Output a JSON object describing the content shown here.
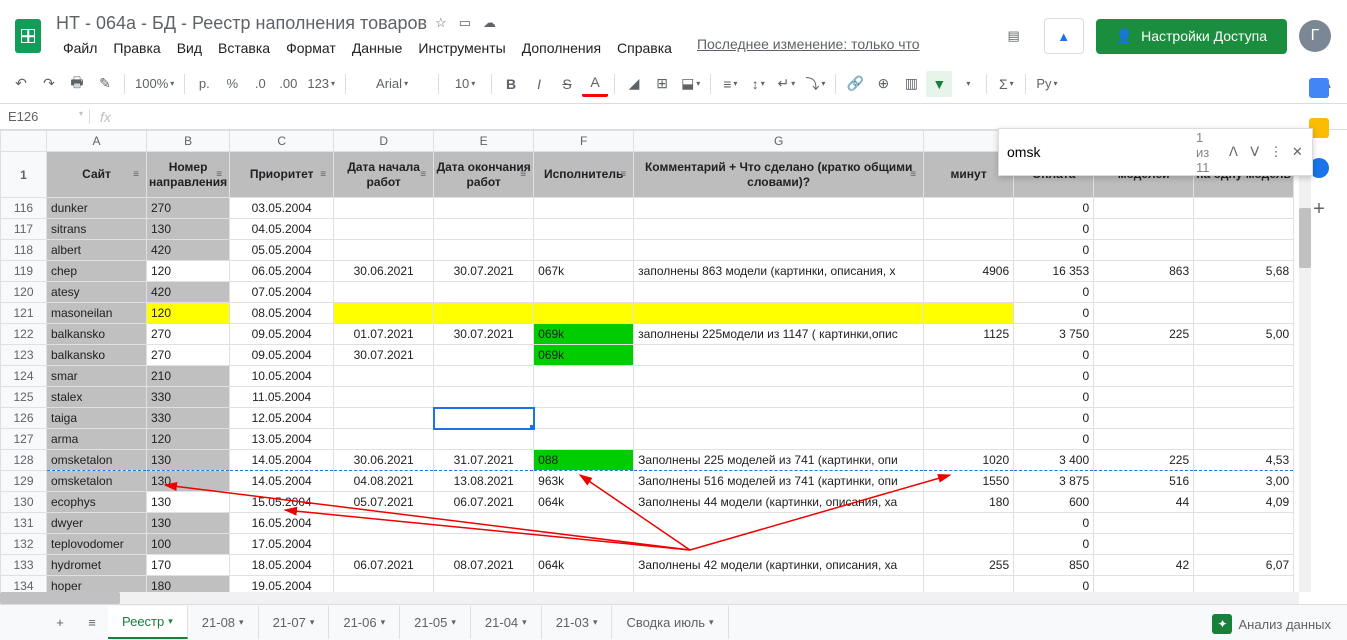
{
  "doc": {
    "title": "НТ - 064а - БД - Реестр наполнения товаров"
  },
  "menu": [
    "Файл",
    "Правка",
    "Вид",
    "Вставка",
    "Формат",
    "Данные",
    "Инструменты",
    "Дополнения",
    "Справка"
  ],
  "last_edit": "Последнее изменение: только что",
  "share": "Настройки Доступа",
  "avatar": "Г",
  "toolbar": {
    "zoom": "100%",
    "currency": "р.",
    "pct": "%",
    "dec_less": ".0",
    "dec_more": ".00",
    "fmt": "123",
    "font": "Arial",
    "size": "10",
    "script": "Ру"
  },
  "name_box": "E126",
  "fx": "fx",
  "find": {
    "query": "omsk",
    "count": "1 из 11"
  },
  "cols": {
    "A": "A",
    "B": "B",
    "C": "C",
    "D": "D",
    "E": "E",
    "F": "F",
    "G": "G",
    "I": "",
    "J": "",
    "K": "",
    "L": ""
  },
  "headers": {
    "A": "Сайт",
    "B": "Номер направления",
    "C": "Приоритет",
    "D": "Дата начала работ",
    "E": "Дата окончания работ",
    "F": "Исполнитель",
    "G": "Комментарий + Что сделано (кратко общими словами)?",
    "I": "минут",
    "J": "Оплата",
    "K": "моделей",
    "L": "на одну модель"
  },
  "rows": [
    {
      "n": "116",
      "site": "dunker",
      "num": "270",
      "prio": "03.05.2004",
      "d1": "",
      "d2": "",
      "exe": "",
      "com": "",
      "min": "",
      "pay": "0",
      "mod": "",
      "per": "",
      "gray": true
    },
    {
      "n": "117",
      "site": "sitrans",
      "num": "130",
      "prio": "04.05.2004",
      "d1": "",
      "d2": "",
      "exe": "",
      "com": "",
      "min": "",
      "pay": "0",
      "mod": "",
      "per": "",
      "gray": true
    },
    {
      "n": "118",
      "site": "albert",
      "num": "420",
      "prio": "05.05.2004",
      "d1": "",
      "d2": "",
      "exe": "",
      "com": "",
      "min": "",
      "pay": "0",
      "mod": "",
      "per": "",
      "gray": true
    },
    {
      "n": "119",
      "site": "chep",
      "num": "120",
      "prio": "06.05.2004",
      "d1": "30.06.2021",
      "d2": "30.07.2021",
      "exe": "067k",
      "com": "заполнены 863 модели (картинки, описания, х",
      "min": "4906",
      "pay": "16 353",
      "mod": "863",
      "per": "5,68"
    },
    {
      "n": "120",
      "site": "atesy",
      "num": "420",
      "prio": "07.05.2004",
      "d1": "",
      "d2": "",
      "exe": "",
      "com": "",
      "min": "",
      "pay": "0",
      "mod": "",
      "per": "",
      "gray": true
    },
    {
      "n": "121",
      "site": "masoneilan",
      "num": "120",
      "prio": "08.05.2004",
      "d1": "",
      "d2": "",
      "exe": "",
      "com": "",
      "min": "",
      "pay": "0",
      "mod": "",
      "per": "",
      "gray": true,
      "yellow": true
    },
    {
      "n": "122",
      "site": "balkansko",
      "num": "270",
      "prio": "09.05.2004",
      "d1": "01.07.2021",
      "d2": "30.07.2021",
      "exe": "069k",
      "com": "заполнены 225модели из 1147 ( картинки,опис",
      "min": "1125",
      "pay": "3 750",
      "mod": "225",
      "per": "5,00",
      "green_exe": true
    },
    {
      "n": "123",
      "site": "balkansko",
      "num": "270",
      "prio": "09.05.2004",
      "d1": "30.07.2021",
      "d2": "",
      "exe": "069k",
      "com": "",
      "min": "",
      "pay": "0",
      "mod": "",
      "per": "",
      "green_exe": true
    },
    {
      "n": "124",
      "site": "smar",
      "num": "210",
      "prio": "10.05.2004",
      "d1": "",
      "d2": "",
      "exe": "",
      "com": "",
      "min": "",
      "pay": "0",
      "mod": "",
      "per": "",
      "gray": true
    },
    {
      "n": "125",
      "site": "stalex",
      "num": "330",
      "prio": "11.05.2004",
      "d1": "",
      "d2": "",
      "exe": "",
      "com": "",
      "min": "",
      "pay": "0",
      "mod": "",
      "per": "",
      "gray": true
    },
    {
      "n": "126",
      "site": "taiga",
      "num": "330",
      "prio": "12.05.2004",
      "d1": "",
      "d2": "",
      "exe": "",
      "com": "",
      "min": "",
      "pay": "0",
      "mod": "",
      "per": "",
      "gray": true,
      "sel": true
    },
    {
      "n": "127",
      "site": "arma",
      "num": "120",
      "prio": "13.05.2004",
      "d1": "",
      "d2": "",
      "exe": "",
      "com": "",
      "min": "",
      "pay": "0",
      "mod": "",
      "per": "",
      "gray": true
    },
    {
      "n": "128",
      "site": "omsketalon",
      "num": "130",
      "prio": "14.05.2004",
      "d1": "30.06.2021",
      "d2": "31.07.2021",
      "exe": "088",
      "com": "Заполнены 225 моделей из 741 (картинки, опи",
      "min": "1020",
      "pay": "3 400",
      "mod": "225",
      "per": "4,53",
      "gray": true,
      "green_exe": true,
      "dash": true
    },
    {
      "n": "129",
      "site": "omsketalon",
      "num": "130",
      "prio": "14.05.2004",
      "d1": "04.08.2021",
      "d2": "13.08.2021",
      "exe": "963k",
      "com": "Заполнены 516 моделей из 741 (картинки, опи",
      "min": "1550",
      "pay": "3 875",
      "mod": "516",
      "per": "3,00",
      "gray": true,
      "dash": true
    },
    {
      "n": "130",
      "site": "ecophys",
      "num": "130",
      "prio": "15.05.2004",
      "d1": "05.07.2021",
      "d2": "06.07.2021",
      "exe": "064k",
      "com": "Заполнены 44 модели (картинки, описания, ха",
      "min": "180",
      "pay": "600",
      "mod": "44",
      "per": "4,09"
    },
    {
      "n": "131",
      "site": "dwyer",
      "num": "130",
      "prio": "16.05.2004",
      "d1": "",
      "d2": "",
      "exe": "",
      "com": "",
      "min": "",
      "pay": "0",
      "mod": "",
      "per": "",
      "gray": true
    },
    {
      "n": "132",
      "site": "teplovodomer",
      "num": "100",
      "prio": "17.05.2004",
      "d1": "",
      "d2": "",
      "exe": "",
      "com": "",
      "min": "",
      "pay": "0",
      "mod": "",
      "per": "",
      "gray": true
    },
    {
      "n": "133",
      "site": "hydromet",
      "num": "170",
      "prio": "18.05.2004",
      "d1": "06.07.2021",
      "d2": "08.07.2021",
      "exe": "064k",
      "com": "Заполнены 42 модели (картинки, описания, ха",
      "min": "255",
      "pay": "850",
      "mod": "42",
      "per": "6,07"
    },
    {
      "n": "134",
      "site": "hoper",
      "num": "180",
      "prio": "19.05.2004",
      "d1": "",
      "d2": "",
      "exe": "",
      "com": "",
      "min": "",
      "pay": "0",
      "mod": "",
      "per": "",
      "gray": true
    }
  ],
  "sheets": [
    "Реестр",
    "21-08",
    "21-07",
    "21-06",
    "21-05",
    "21-04",
    "21-03",
    "Сводка июль"
  ],
  "analyze": "Анализ данных",
  "row_1": "1"
}
